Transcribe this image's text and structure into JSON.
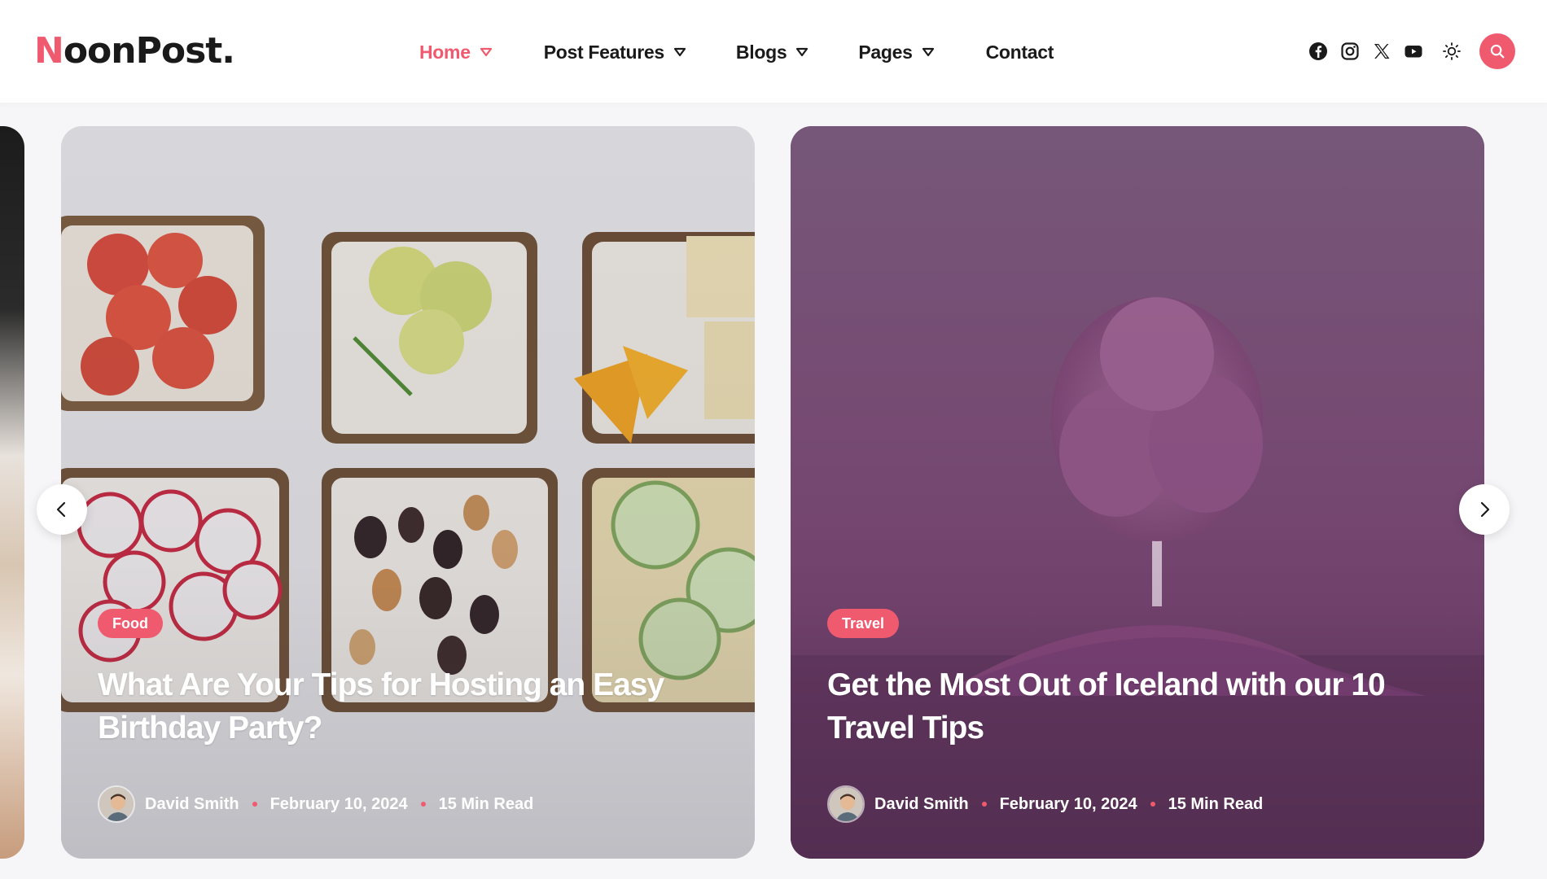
{
  "brand": {
    "logo_first": "N",
    "logo_rest": "oonPost.",
    "accent": "#ef5a6f"
  },
  "nav": {
    "home": "Home",
    "post_features": "Post Features",
    "blogs": "Blogs",
    "pages": "Pages",
    "contact": "Contact"
  },
  "header_icons": [
    "facebook-icon",
    "instagram-icon",
    "x-icon",
    "youtube-icon",
    "sun-icon",
    "search-icon"
  ],
  "slides": [
    {
      "category": "Food",
      "title": "What Are Your Tips for Hosting an Easy Birthday Party?",
      "author": "David Smith",
      "date": "February 10, 2024",
      "read_time": "15 Min Read"
    },
    {
      "category": "Travel",
      "title": "Get the Most Out of Iceland with our 10 Travel Tips",
      "author": "David Smith",
      "date": "February 10, 2024",
      "read_time": "15 Min Read"
    }
  ]
}
